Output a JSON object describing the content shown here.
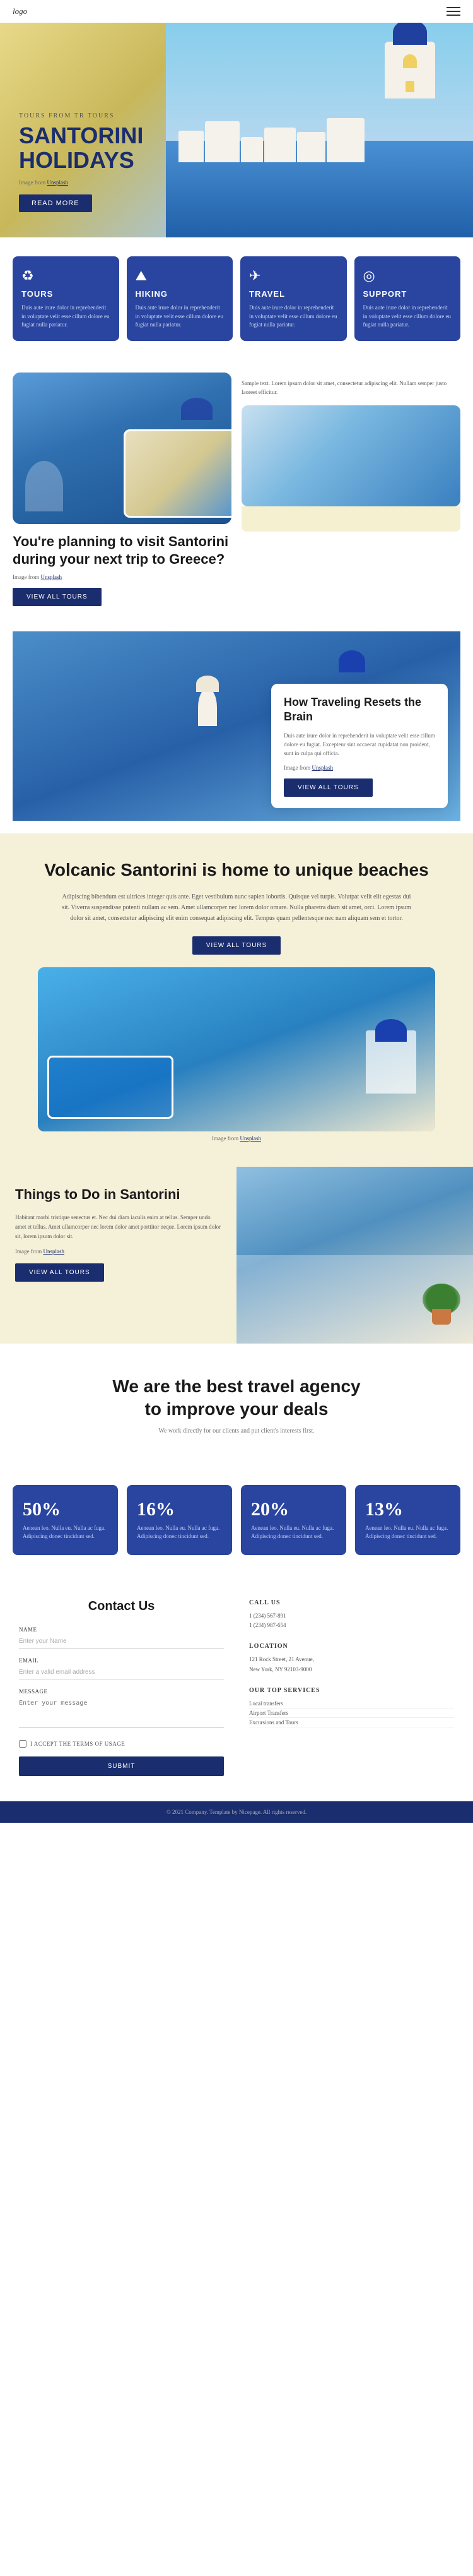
{
  "header": {
    "logo": "logo",
    "nav_icon": "≡"
  },
  "hero": {
    "subtitle": "TOURS FROM TR TOURS",
    "title_line1": "SANTORINI",
    "title_line2": "HOLIDAYS",
    "image_credit_text": "Image from ",
    "image_credit_link": "Unsplash",
    "btn_label": "READ MORE"
  },
  "services": [
    {
      "id": "tours",
      "icon": "♻",
      "title": "TOURS",
      "text": "Duis aute irure dolor in reprehenderit in voluptate velit esse cillum dolore eu fugiat nulla pariatur."
    },
    {
      "id": "hiking",
      "icon": "⛰",
      "title": "HIKING",
      "text": "Duis aute irure dolor in reprehenderit in voluptate velit esse cillum dolore eu fugiat nulla pariatur."
    },
    {
      "id": "travel",
      "icon": "✈",
      "title": "TRAVEL",
      "text": "Duis aute irure dolor in reprehenderit in voluptate velit esse cillum dolore eu fugiat nulla pariatur."
    },
    {
      "id": "support",
      "icon": "◎",
      "title": "SUPPORT",
      "text": "Duis aute irure dolor in reprehenderit in voluptate velit esse cillum dolore eu fugiat nulla pariatur."
    }
  ],
  "planning": {
    "sample_text": "Sample text. Lorem ipsum dolor sit amet, consectetur adipiscing elit. Nullam semper justo laoreet efficitur.",
    "title": "You're planning to visit Santorini during your next trip to Greece?",
    "image_credit_text": "Image from ",
    "image_credit_link": "Unsplash",
    "btn_label": "VIEW ALL TOURS"
  },
  "resets": {
    "title": "How Traveling Resets the Brain",
    "text": "Duis aute irure dolor in reprehenderit in voluptate velit esse cillum dolore eu fugiat. Excepteur sint occaecat cupidatat non proident, sunt in culpa qui officia.",
    "image_credit_text": "Image from ",
    "image_credit_link": "Unsplash",
    "btn_label": "VIEW ALL TOURS"
  },
  "volcanic": {
    "title": "Volcanic Santorini is home to unique beaches",
    "text": "Adipiscing bibendum est ultrices integer quis ante. Eget vestibulum nunc sapien lobortis. Quisque vel turpis. Volutpat velit elit egestas dui sit. Viverra suspendisse potenti nullam ac sem. Amet ullamcorper nec lorem dolor ornare. Nulla pharetra diam sit amet, orci. Lorem ipsum dolor sit amet, consectetur adipiscing elit enim consequat adipiscing elit. Tempus quam pellentesque nec nam aliquam sem et tortor.",
    "btn_label": "VIEW ALL TOURS",
    "image_credit_text": "Image from ",
    "image_credit_link": "Unsplash"
  },
  "things": {
    "title": "Things to Do in Santorini",
    "text": "Habitant morbi tristique senectus et. Nec dui diam iaculis enim at tellus. Semper undo amet et tellus. Amet ullamcorper nec lorem dolor amet porttitor neque. Lorem ipsum dolor sit, lorem ipsum dolor sit.",
    "image_credit_text": "Image from ",
    "image_credit_link": "Unsplash",
    "btn_label": "VIEW ALL TOURS"
  },
  "agency": {
    "title_line1": "We are the best travel agency",
    "title_line2": "to improve your deals",
    "text": "We work directly for our clients and put client's interests first."
  },
  "stats": [
    {
      "number": "50%",
      "text": "Aenean leo. Nulla eu. Nulla ac fuga. Adipiscing donec tincidunt sed."
    },
    {
      "number": "16%",
      "text": "Aenean leo. Nulla eu. Nulla ac fuga. Adipiscing donec tincidunt sed."
    },
    {
      "number": "20%",
      "text": "Aenean leo. Nulla eu. Nulla ac fuga. Adipiscing donec tincidunt sed."
    },
    {
      "number": "13%",
      "text": "Aenean leo. Nulla eu. Nulla ac fuga. Adipiscing donec tincidunt sed."
    }
  ],
  "contact": {
    "title": "Contact Us",
    "form": {
      "name_label": "Name",
      "name_placeholder": "Enter your Name",
      "email_label": "Email",
      "email_placeholder": "Enter a valid email address",
      "message_label": "Message",
      "message_placeholder": "Enter your message",
      "terms_text": "I accept the Terms of Usage",
      "submit_label": "SUBMIT"
    },
    "call_us_title": "CALL US",
    "phone1": "1 (234) 567-891",
    "phone2": "1 (234) 987-654",
    "location_title": "LOCATION",
    "address": "121 Rock Street, 21 Avenue,\nNew York, NY 92103-9000",
    "services_title": "OUR TOP SERVICES",
    "services": [
      "Local transfers",
      "Airport Transfers",
      "Excursions and Tours"
    ]
  },
  "footer": {
    "text": "© 2021 Company. Template by Nicepage. All rights reserved."
  }
}
